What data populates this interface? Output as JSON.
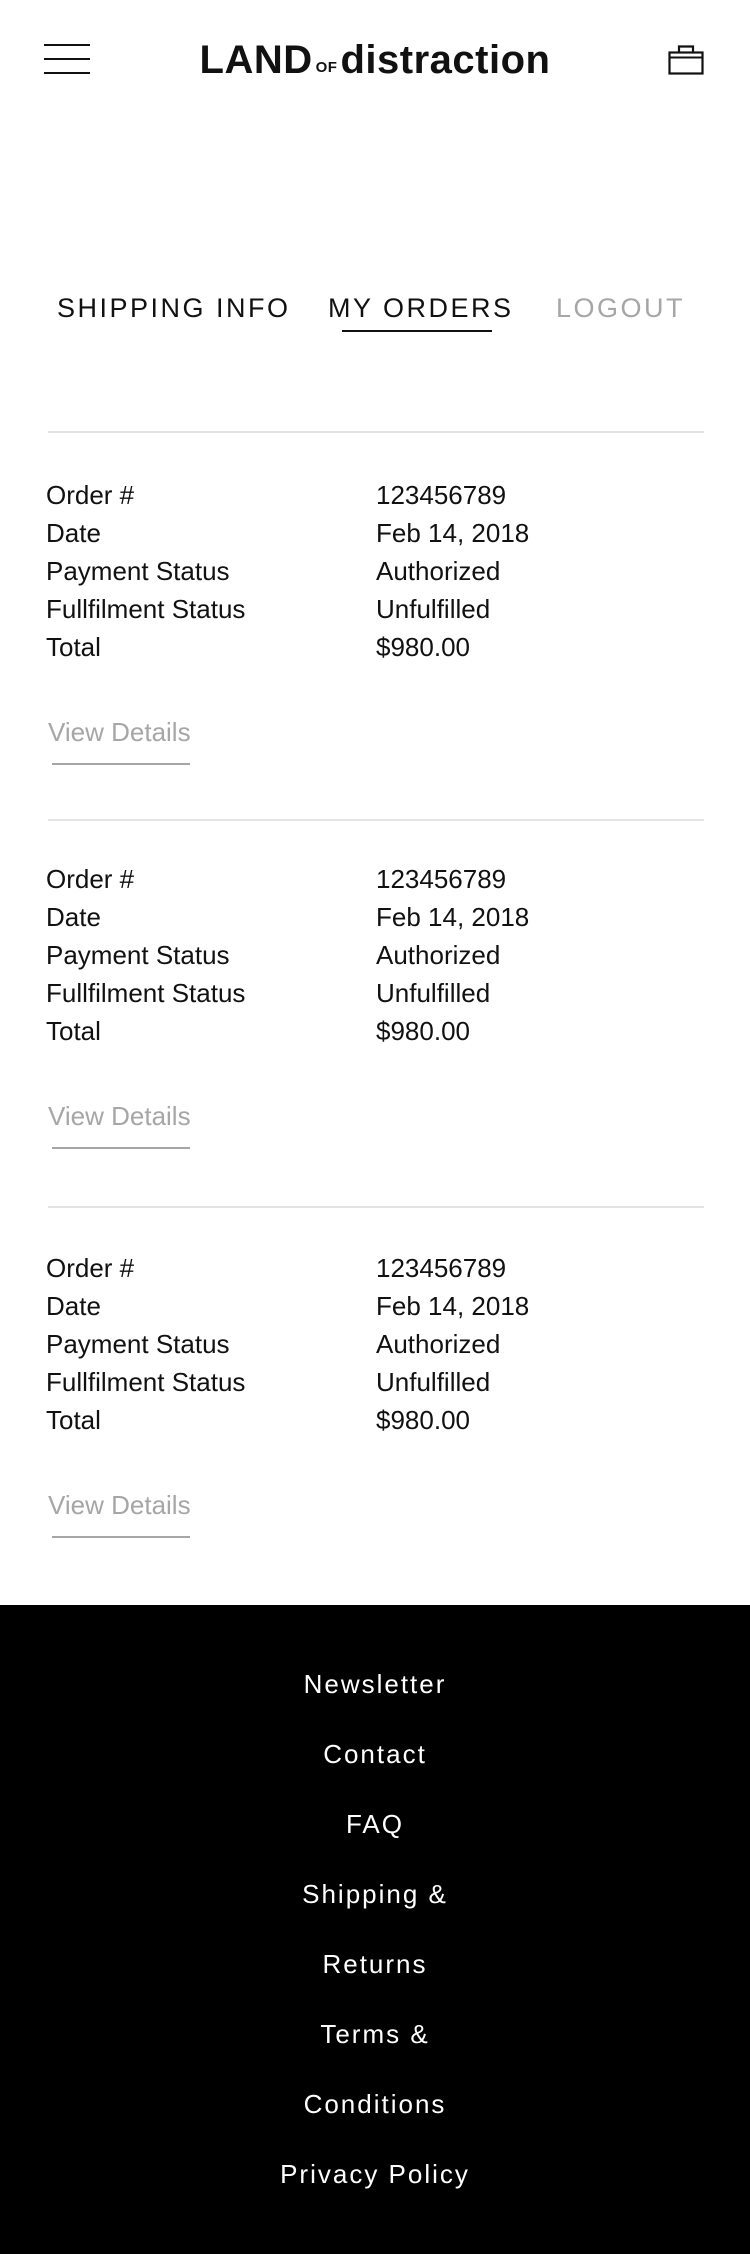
{
  "header": {
    "logo_part1": "LAND",
    "logo_part2": "OF",
    "logo_part3": "distraction",
    "menu_icon": "hamburger-menu-icon",
    "cart_icon": "bag-icon"
  },
  "tabs": [
    {
      "label": "SHIPPING INFO"
    },
    {
      "label": "MY ORDERS",
      "active": true
    },
    {
      "label": "LOGOUT"
    }
  ],
  "orders": [
    {
      "fields": [
        {
          "label": "Order #",
          "value": "123456789"
        },
        {
          "label": "Date",
          "value": "Feb 14, 2018"
        },
        {
          "label": "Payment Status",
          "value": "Authorized"
        },
        {
          "label": "Fullfilment Status",
          "value": "Unfulfilled"
        },
        {
          "label": "Total",
          "value": "$980.00"
        }
      ],
      "action": "View Details"
    },
    {
      "fields": [
        {
          "label": "Order #",
          "value": "123456789"
        },
        {
          "label": "Date",
          "value": "Feb 14, 2018"
        },
        {
          "label": "Payment Status",
          "value": "Authorized"
        },
        {
          "label": "Fullfilment Status",
          "value": "Unfulfilled"
        },
        {
          "label": "Total",
          "value": "$980.00"
        }
      ],
      "action": "View Details"
    },
    {
      "fields": [
        {
          "label": "Order #",
          "value": "123456789"
        },
        {
          "label": "Date",
          "value": "Feb 14, 2018"
        },
        {
          "label": "Payment Status",
          "value": "Authorized"
        },
        {
          "label": "Fullfilment Status",
          "value": "Unfulfilled"
        },
        {
          "label": "Total",
          "value": "$980.00"
        }
      ],
      "action": "View Details"
    }
  ],
  "footer": {
    "links": [
      "Newsletter",
      "Contact",
      "FAQ",
      "Shipping &",
      "Returns",
      "Terms &",
      "Conditions",
      "Privacy Policy"
    ]
  },
  "colors": {
    "text": "#111111",
    "muted": "#a6a6a6",
    "divider": "#e3e3e3",
    "footer_bg": "#000000",
    "footer_text": "#ffffff"
  }
}
